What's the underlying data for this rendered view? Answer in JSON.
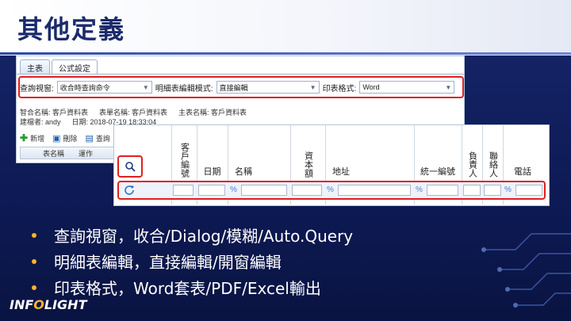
{
  "slide": {
    "title": "其他定義",
    "bullets": [
      "查詢視窗，收合/Dialog/模糊/Auto.Query",
      "明細表編輯，直接編輯/開窗編輯",
      "印表格式，Word套表/PDF/Excel輸出"
    ],
    "logo": {
      "left": "INF",
      "o": "O",
      "right": "LIGHT"
    }
  },
  "panel1": {
    "tabs": [
      "主表",
      "公式設定"
    ],
    "options": {
      "query_label": "查詢視窗:",
      "query_value": "收合時查詢命令",
      "detail_label": "明細表編輯模式:",
      "detail_value": "直接編輯",
      "print_label": "印表格式:",
      "print_value": "Word"
    },
    "info": [
      [
        "智合名稱: 客戶資料表",
        "表單名稱: 客戶資料表",
        "主表名稱: 客戶資料表"
      ],
      [
        "建檔者: andy",
        "日期: 2018-07-19 18:33:04"
      ]
    ],
    "toolbar": {
      "add": "新增",
      "delete": "刪除",
      "query": "查詢"
    },
    "grid_headers": [
      "表名稱",
      "運作"
    ]
  },
  "panel2": {
    "columns": [
      "客戶編號",
      "日期",
      "名稱",
      "資本額",
      "地址",
      "統一編號",
      "負責人",
      "聯絡人",
      "電話"
    ],
    "pct": "%"
  },
  "colors": {
    "accent": "#e02020",
    "bullet_dot": "#ffb429",
    "title": "#1b2a6b"
  },
  "icons": [
    "search-icon",
    "refresh-icon",
    "plus-icon",
    "delete-icon",
    "dropdown-caret-icon"
  ]
}
